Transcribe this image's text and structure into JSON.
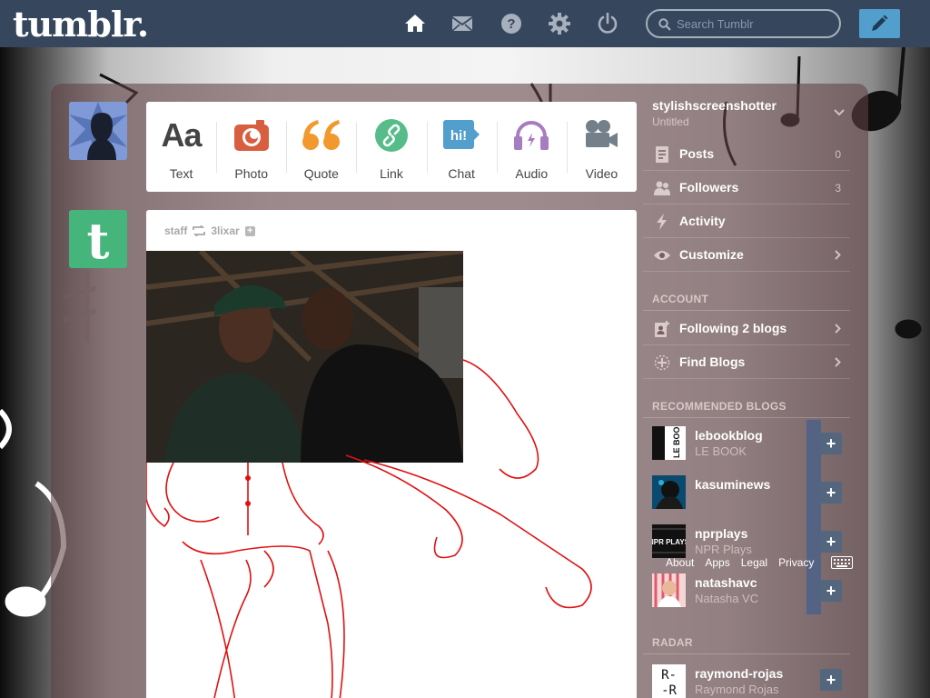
{
  "header": {
    "logo": "tumblr.",
    "search_placeholder": "Search Tumblr"
  },
  "post_types": [
    {
      "label": "Text",
      "icon": "text-icon",
      "color": "#444444"
    },
    {
      "label": "Photo",
      "icon": "camera-icon",
      "color": "#d95e40"
    },
    {
      "label": "Quote",
      "icon": "quote-icon",
      "color": "#f2992e"
    },
    {
      "label": "Link",
      "icon": "link-icon",
      "color": "#56bc8a"
    },
    {
      "label": "Chat",
      "icon": "chat-icon",
      "color": "#529ecc"
    },
    {
      "label": "Audio",
      "icon": "headphones-icon",
      "color": "#a77dc2"
    },
    {
      "label": "Video",
      "icon": "video-camera-icon",
      "color": "#748089"
    }
  ],
  "post_types_text_glyph": "Aa",
  "post": {
    "author": "staff",
    "reblogged_from": "3lixar",
    "chat_glyph": "hi!"
  },
  "sidebar": {
    "blog_name": "stylishscreenshotter",
    "blog_title": "Untitled",
    "items": [
      {
        "label": "Posts",
        "count": "0"
      },
      {
        "label": "Followers",
        "count": "3"
      },
      {
        "label": "Activity"
      },
      {
        "label": "Customize"
      }
    ],
    "account_heading": "ACCOUNT",
    "account_items": [
      {
        "label": "Following 2 blogs"
      },
      {
        "label": "Find Blogs"
      }
    ],
    "recommended_heading": "RECOMMENDED BLOGS",
    "recommended": [
      {
        "name": "lebookblog",
        "subtitle": "LE BOOK",
        "thumb_text": "LE BOOK"
      },
      {
        "name": "kasuminews",
        "subtitle": ""
      },
      {
        "name": "nprplays",
        "subtitle": "NPR Plays",
        "thumb_text": "NPR PLAYS"
      },
      {
        "name": "natashavc",
        "subtitle": "Natasha VC"
      }
    ],
    "follow_label": "+",
    "footer_links": [
      "About",
      "Apps",
      "Legal",
      "Privacy"
    ],
    "radar_heading": "RADAR",
    "radar": {
      "name": "raymond-rojas",
      "subtitle": "Raymond Rojas",
      "thumb_text": "R- -R"
    }
  },
  "colors": {
    "nav": "#36465d",
    "compose": "#529ecc",
    "staff_avatar": "#46b57c"
  }
}
